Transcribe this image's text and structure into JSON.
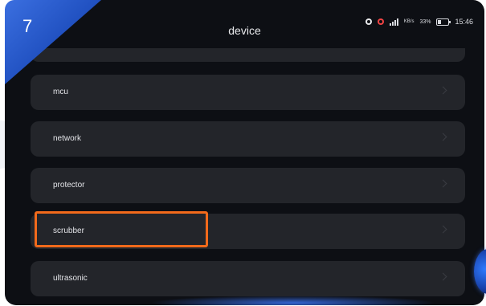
{
  "step": {
    "number": "7"
  },
  "header": {
    "title": "device"
  },
  "status_bar": {
    "net_speed": "KB/s",
    "battery": "33%",
    "time": "15:46"
  },
  "list": {
    "items": [
      {
        "label": "mcu"
      },
      {
        "label": "network"
      },
      {
        "label": "protector"
      },
      {
        "label": "scrubber"
      },
      {
        "label": "ultrasonic"
      }
    ]
  },
  "colors": {
    "highlight": "#f26a1b",
    "accent_blue": "#2f6ae0",
    "row_bg": "#23252a",
    "screen_bg": "#0d0f14"
  }
}
